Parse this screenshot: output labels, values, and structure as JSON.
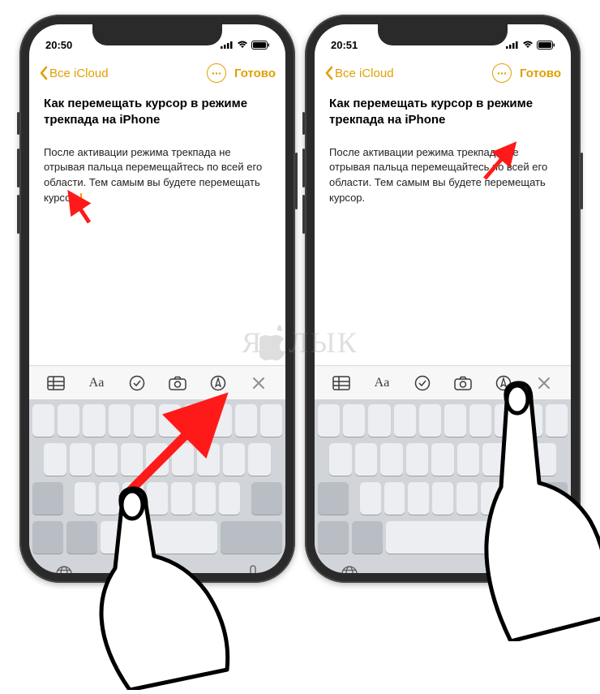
{
  "accent": "#e0a000",
  "watermark": "Я ЛЫК",
  "phones": [
    {
      "time": "20:50",
      "back": "Все iCloud",
      "done": "Готово",
      "title": "Как перемещать курсор в режиме трекпада на iPhone",
      "body_before": "После активации режима трекпада не отрывая пальца перемещайтесь по всей его области. Тем самым вы будете перемещать курсор.",
      "body_after": "",
      "toolbar_text": "Aa"
    },
    {
      "time": "20:51",
      "back": "Все iCloud",
      "done": "Готово",
      "title": "Как перемещать курсор в режиме трекпада на iPhone",
      "body_before": "После активации режима трекпада",
      "body_after": " не отрывая пальца перемещайтесь по всей его области. Тем самым вы будете перемещать курсор.",
      "toolbar_text": "Aa"
    }
  ]
}
